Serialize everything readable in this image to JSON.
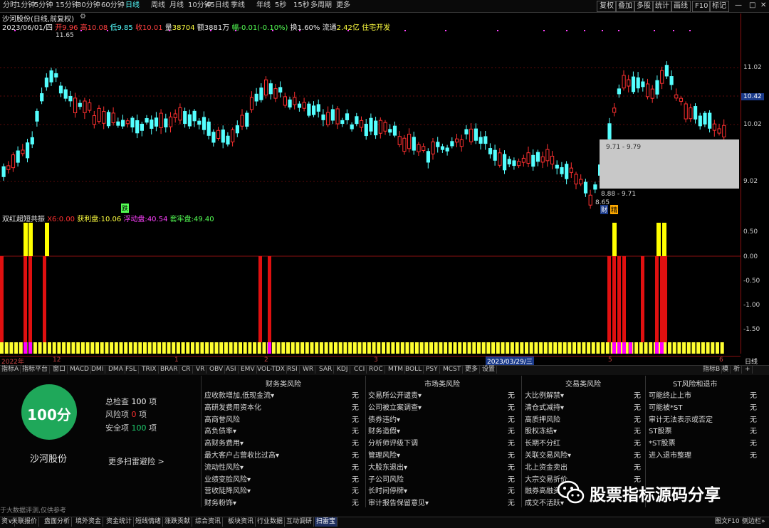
{
  "toolbar": {
    "periods": [
      "分时",
      "1分钟",
      "5分钟",
      "15分钟",
      "30分钟",
      "60分钟",
      "日线",
      "周线",
      "月线",
      "10分钟",
      "45日线",
      "季线",
      "年线",
      "5秒",
      "15秒",
      "多周期",
      "更多"
    ],
    "right_buttons": [
      "复权",
      "叠加",
      "多股",
      "统计",
      "画线",
      "F10",
      "标记"
    ]
  },
  "stock": {
    "title": "沙河股份(日线,前复权)",
    "date": "2023/06/01/四",
    "open_label": "开",
    "open": "9.96",
    "high_label": "高",
    "high": "10.08",
    "low_label": "低",
    "low": "9.85",
    "close_label": "收",
    "close": "10.01",
    "vol_label": "量",
    "vol": "38704",
    "amount_label": "额",
    "amount": "3881万",
    "change_label": "幅",
    "change": "-0.01(-0.10%)",
    "turnover_label": "换",
    "turnover": "1.60%",
    "float_label": "流通",
    "float": "2.42亿",
    "sector": "住宅开发"
  },
  "price_chart": {
    "y_labels": [
      "11.02",
      "10.42",
      "10.02",
      "9.02"
    ],
    "max_label": "11.65",
    "min_label": "8.65",
    "range1": "9.71 - 9.79",
    "range2": "8.88 - 9.71",
    "current_price": "10.42",
    "marker_left": "跌",
    "marker_cai": "财",
    "marker_jing": "精"
  },
  "indicator": {
    "name": "双红超短共振",
    "x6_label": "X6:",
    "x6": "0.00",
    "profit_label": "获利盘:",
    "profit": "10.06",
    "float_label": "浮动盘:",
    "float": "40.54",
    "trap_label": "套牢盘:",
    "trap": "49.40",
    "y_labels": [
      "0.50",
      "0.00",
      "-0.50",
      "-1.00",
      "-1.50"
    ]
  },
  "date_axis": {
    "labels": [
      "2022年",
      "12",
      "1",
      "2",
      "3",
      "2023/03/29/三",
      "5",
      "6"
    ],
    "right": "日线"
  },
  "tabs": {
    "items": [
      "指标A",
      "指标平台",
      "窗口",
      "MACD",
      "DMI",
      "DMA",
      "FSL",
      "TRIX",
      "BRAR",
      "CR",
      "VR",
      "OBV",
      "ASI",
      "EMV",
      "VOL-TDX",
      "RSI",
      "WR",
      "SAR",
      "KDJ",
      "CCI",
      "ROC",
      "MTM",
      "BOLL",
      "PSY",
      "MCST",
      "更多",
      "设置"
    ],
    "right": [
      "指标B",
      "模",
      "析",
      "+"
    ]
  },
  "risk": {
    "score": "100分",
    "stock_name": "沙河股份",
    "total_label": "总检查",
    "total": "100",
    "total_unit": "项",
    "risk_label": "风险项",
    "risk": "0",
    "risk_unit": "项",
    "safe_label": "安全项",
    "safe": "100",
    "safe_unit": "项",
    "more": "更多扫雷避险 >",
    "note": "于大数据评测,仅供参考",
    "columns": [
      {
        "title": "财务类风险",
        "items": [
          "应收款增加,低现金流▾",
          "高研发费用资本化",
          "高商誉风险",
          "高负债率▾",
          "高财务费用▾",
          "最大客户占营收比过高▾",
          "流动性风险▾",
          "业绩变脸风险▾",
          "营收陡降风险▾",
          "财务粉饰▾"
        ],
        "values": [
          "无",
          "无",
          "无",
          "无",
          "无",
          "无",
          "无",
          "无",
          "无",
          "无"
        ]
      },
      {
        "title": "市场类风险",
        "items": [
          "交易所公开谴责▾",
          "公司被立案调查▾",
          "债券违约▾",
          "财务造假▾",
          "分析师评级下调",
          "管理风险▾",
          "大股东退出▾",
          "子公司风险",
          "长时间停牌▾",
          "审计报告保留意见▾"
        ],
        "values": [
          "无",
          "无",
          "无",
          "无",
          "无",
          "无",
          "无",
          "无",
          "无",
          "无"
        ]
      },
      {
        "title": "交易类风险",
        "items": [
          "大比例解禁▾",
          "清仓式减持▾",
          "高质押风险",
          "股权冻结▾",
          "长期不分红",
          "关联交易风险▾",
          "北上资金卖出",
          "大宗交易折价",
          "融券高融资",
          "成交不活跃▾"
        ],
        "values": [
          "无",
          "无",
          "无",
          "无",
          "无",
          "无",
          "无",
          "无",
          "",
          ""
        ]
      },
      {
        "title": "ST风险和退市",
        "items": [
          "可能终止上市",
          "可能被*ST",
          "审计无法表示或否定",
          "ST股票",
          "*ST股票",
          "进入退市整理"
        ],
        "values": [
          "无",
          "无",
          "无",
          "无",
          "无",
          "无"
        ]
      }
    ]
  },
  "watermark": "股票指标源码分享",
  "bottom_bar": {
    "items": [
      "资∨",
      "关联报价",
      "盘面分析",
      "境外资金",
      "资金统计",
      "短线情绪",
      "涨跌贡献",
      "综合资讯",
      "板块资讯",
      "行业数据",
      "互动调研",
      "扫雷宝"
    ],
    "right": "图文F10",
    "right2": "侧边栏»"
  },
  "colors": {
    "up": "#ff3030",
    "down": "#54ffff",
    "yellow": "#ffff00",
    "magenta": "#ff00ff",
    "red": "#e01010",
    "grid": "#8a1010",
    "panel_green": "#1fa85a"
  }
}
